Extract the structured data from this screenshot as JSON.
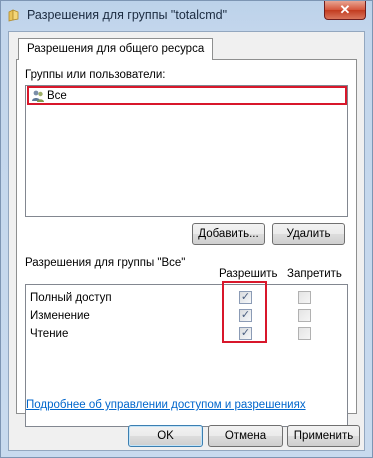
{
  "window": {
    "title": "Разрешения для группы \"totalcmd\"",
    "close_label": "✕"
  },
  "tab": {
    "label": "Разрешения для общего ресурса"
  },
  "groups": {
    "label": "Группы или пользователи:",
    "items": [
      {
        "name": "Все",
        "icon": "users-group-icon",
        "selected": true
      }
    ],
    "add_button": "Добавить...",
    "remove_button": "Удалить"
  },
  "permissions": {
    "label": "Разрешения для группы \"Все\"",
    "allow_header": "Разрешить",
    "deny_header": "Запретить",
    "rows": [
      {
        "name": "Полный доступ",
        "allow": true,
        "deny": false
      },
      {
        "name": "Изменение",
        "allow": true,
        "deny": false
      },
      {
        "name": "Чтение",
        "allow": true,
        "deny": false
      }
    ]
  },
  "help_link": "Подробнее об управлении доступом и разрешениях",
  "buttons": {
    "ok": "OK",
    "cancel": "Отмена",
    "apply": "Применить"
  },
  "highlight_color": "#d8172b"
}
